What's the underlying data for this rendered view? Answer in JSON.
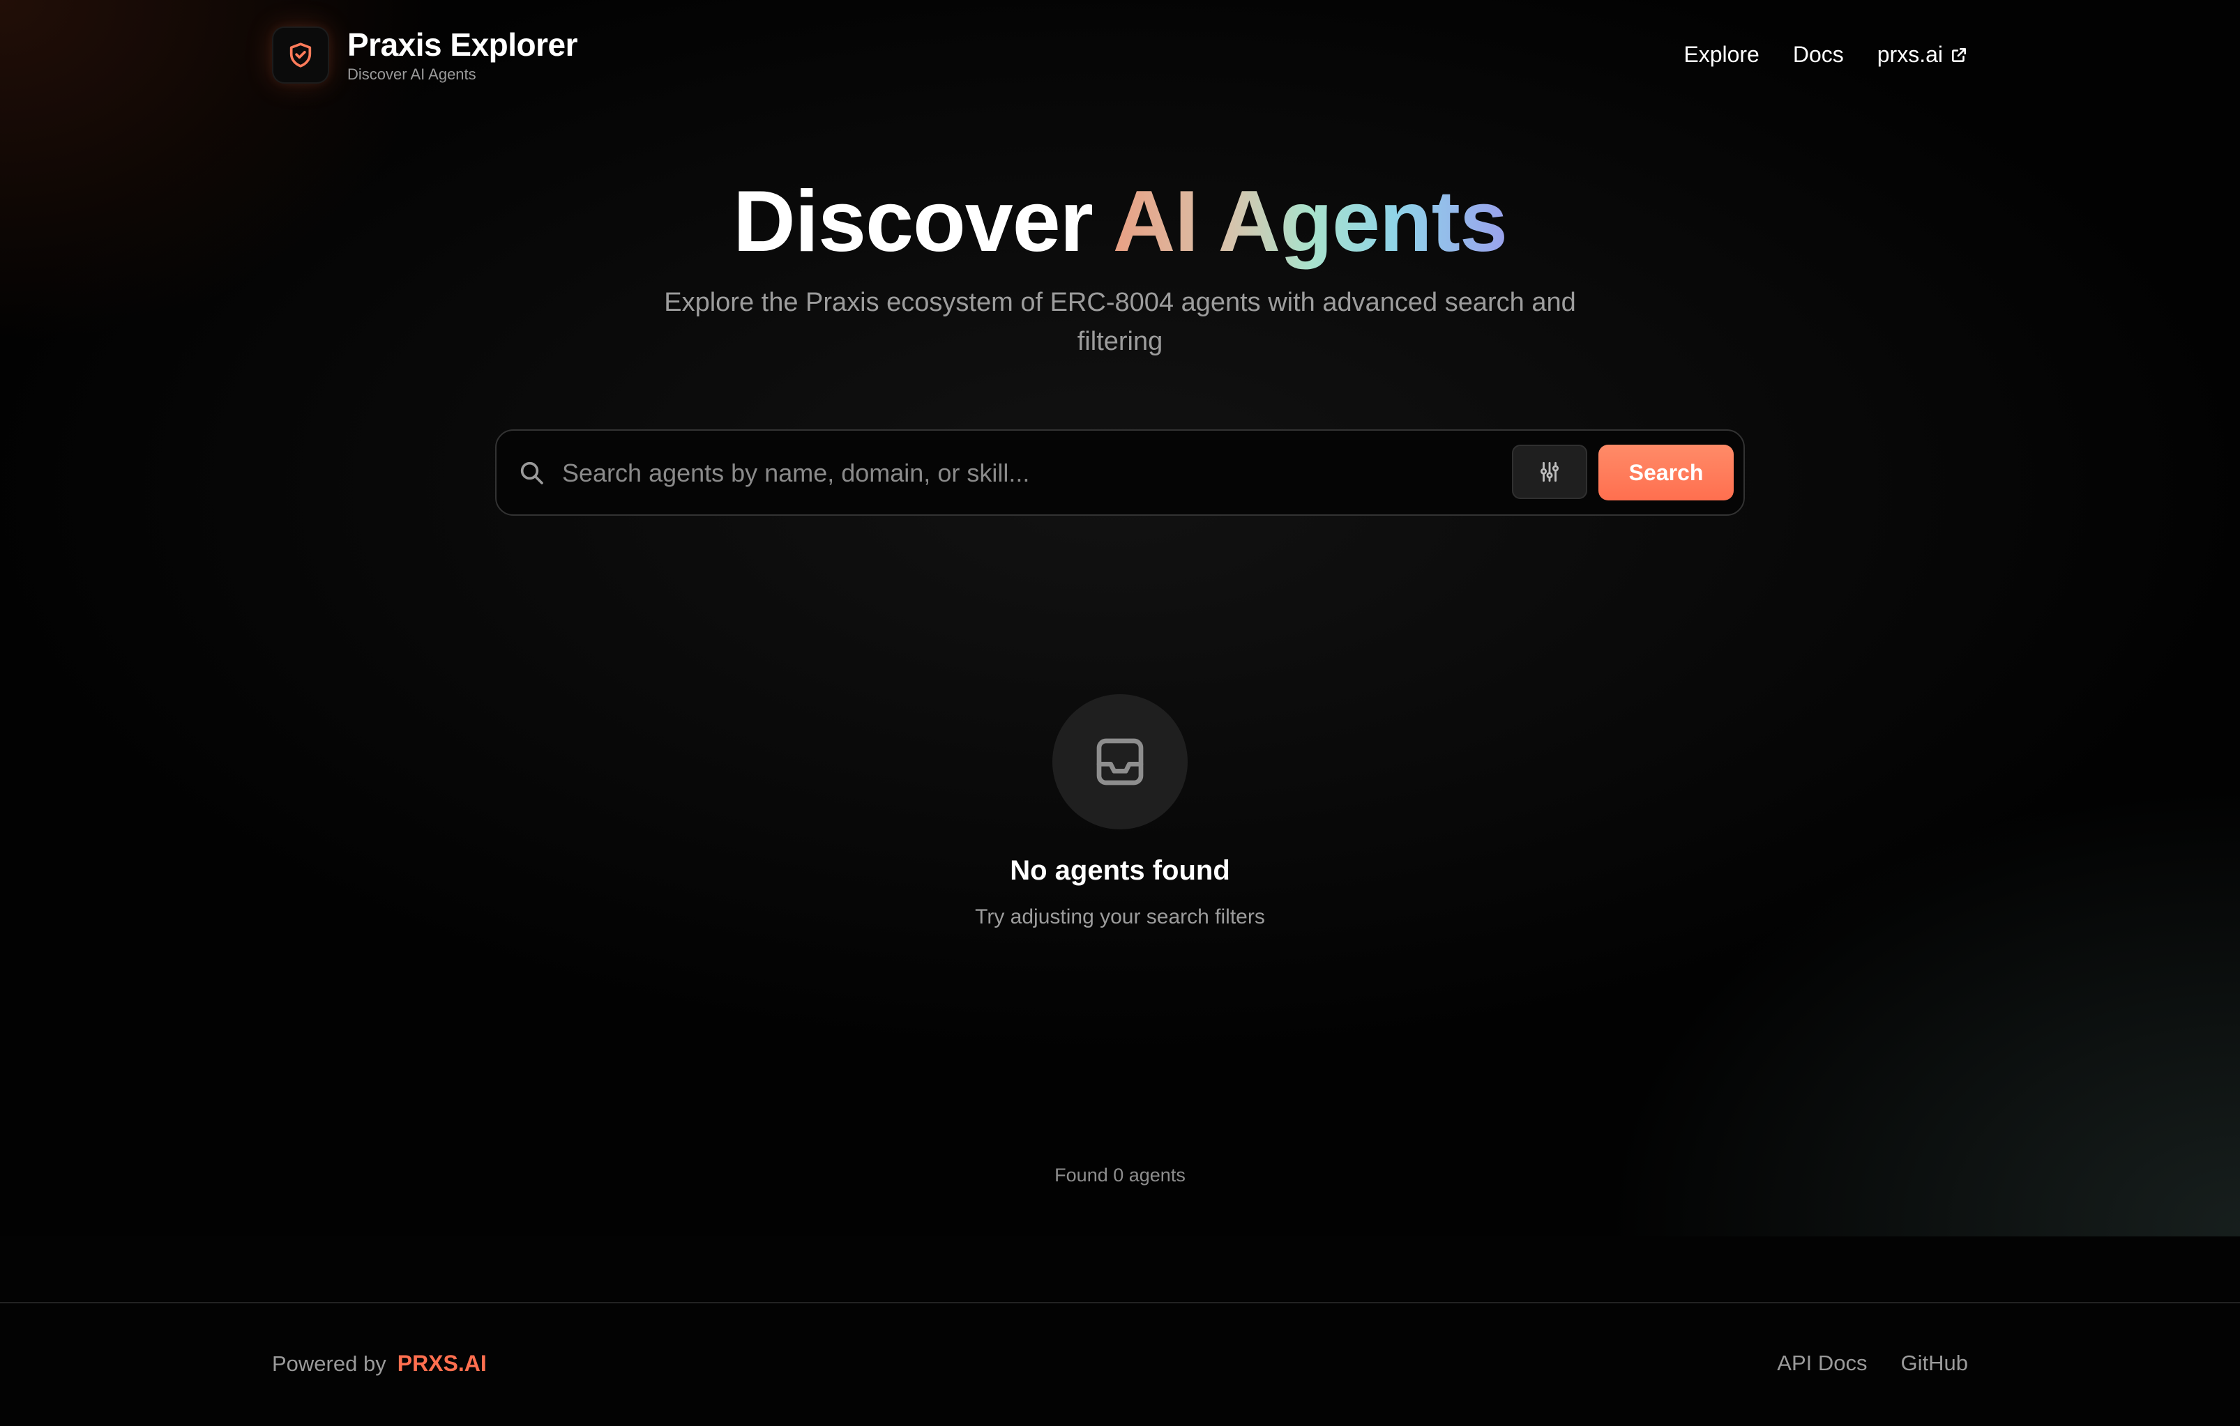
{
  "brand": {
    "title": "Praxis Explorer",
    "subtitle": "Discover AI Agents",
    "logo_icon": "shield-check-icon",
    "accent": "#ff6f4f"
  },
  "nav": {
    "explore": "Explore",
    "docs": "Docs",
    "external": "prxs.ai",
    "external_icon": "external-link-icon"
  },
  "hero": {
    "title_plain": "Discover",
    "title_gradient": "AI Agents",
    "subtitle": "Explore the Praxis ecosystem of ERC-8004 agents with advanced search and filtering"
  },
  "search": {
    "placeholder": "Search agents by name, domain, or skill...",
    "value": "",
    "button_label": "Search",
    "search_icon": "search-icon",
    "filter_icon": "sliders-icon"
  },
  "empty_state": {
    "icon": "inbox-icon",
    "title": "No agents found",
    "subtitle": "Try adjusting your search filters"
  },
  "results": {
    "count_text": "Found 0 agents"
  },
  "footer": {
    "powered_by": "Powered by",
    "powered_brand": "PRXS.AI",
    "links": [
      "API Docs",
      "GitHub"
    ]
  }
}
